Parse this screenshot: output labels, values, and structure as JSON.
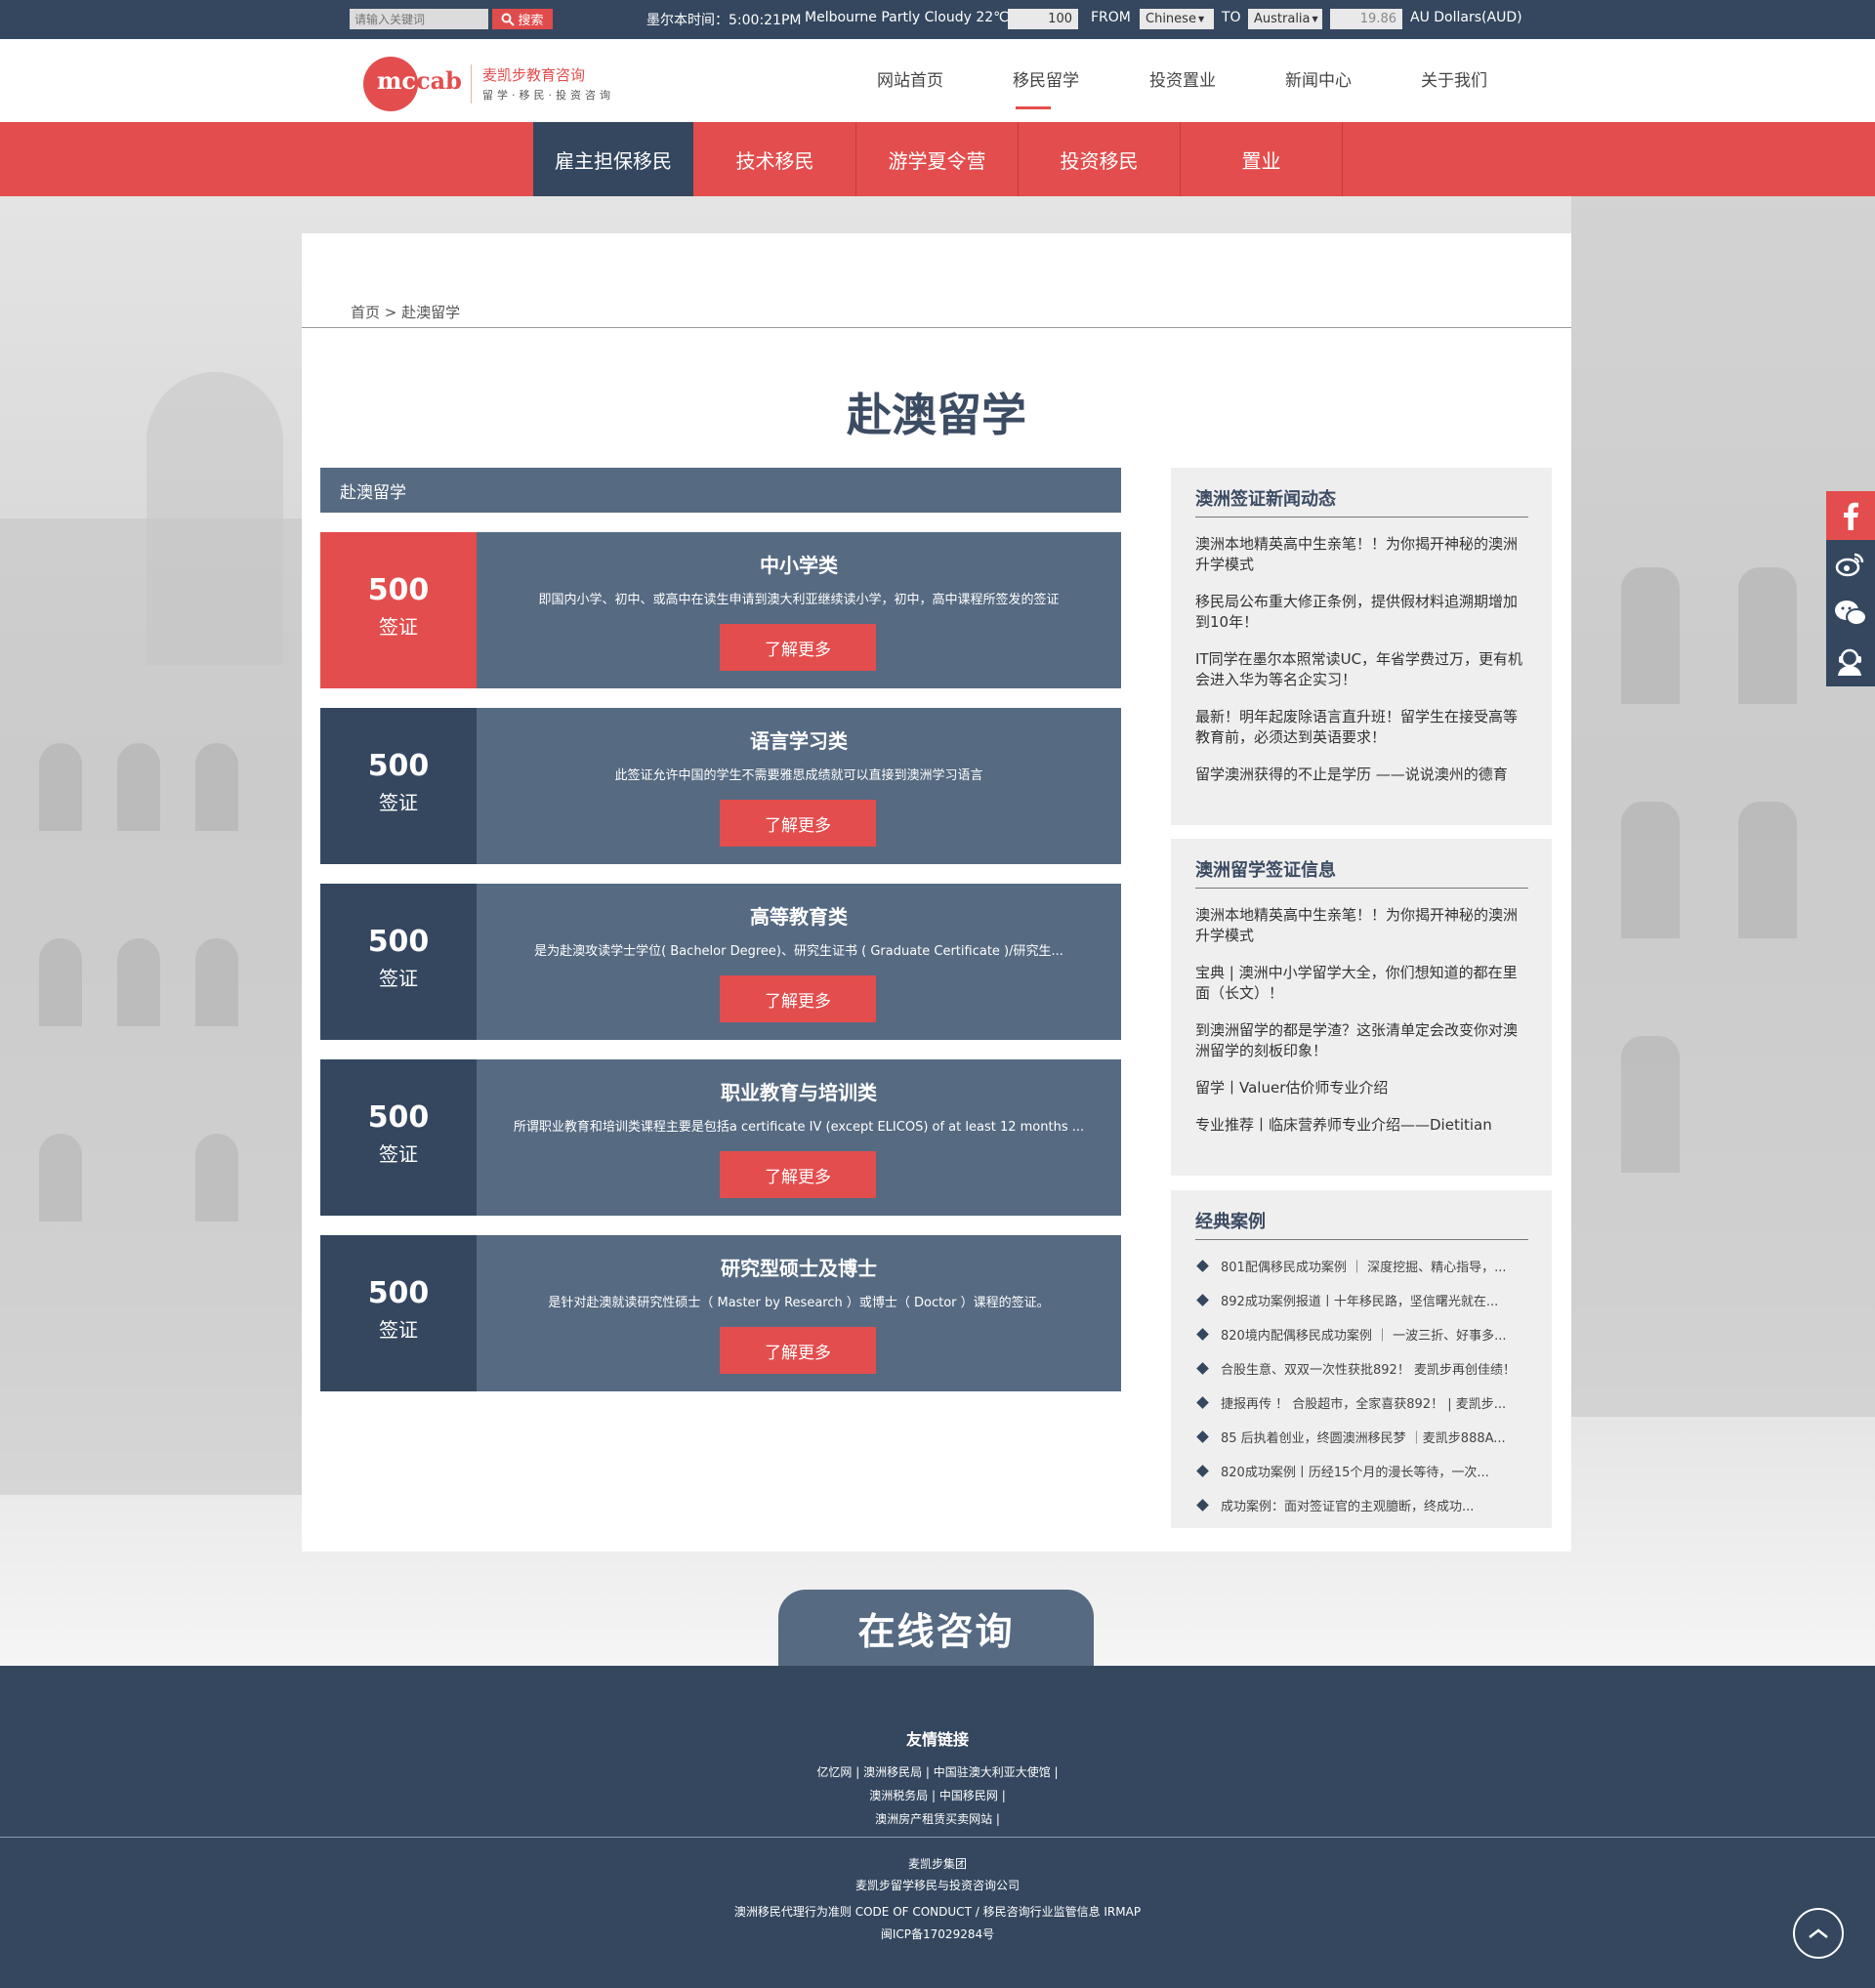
{
  "topbar": {
    "search_placeholder": "请输入关键词",
    "search_button": "搜索",
    "time_label": "墨尔本时间：5:00:21PM",
    "weather": "Melbourne Partly Cloudy 22℃",
    "amount": "100",
    "from_label": "FROM",
    "from_currency": "Chinese",
    "to_label": "TO",
    "to_currency": "Australia",
    "result": "19.86",
    "result_unit": "AU Dollars(AUD)"
  },
  "header": {
    "logo_mc": "mc",
    "logo_cab": "cab",
    "brand_cn": "麦凯步教育咨询",
    "brand_sub": "留学·移民·投资咨询",
    "nav": [
      "网站首页",
      "移民留学",
      "投资置业",
      "新闻中心",
      "关于我们"
    ]
  },
  "subnav": [
    "雇主担保移民",
    "技术移民",
    "游学夏令营",
    "投资移民",
    "置业"
  ],
  "breadcrumb": {
    "home": "首页",
    "separator": ">",
    "current": "赴澳留学"
  },
  "page_title": "赴澳留学",
  "category_header": "赴澳留学",
  "cards": [
    {
      "num": "500",
      "visa": "签证",
      "title": "中小学类",
      "desc": "即国内小学、初中、或高中在读生申请到澳大利亚继续读小学，初中，高中课程所签发的签证",
      "button": "了解更多"
    },
    {
      "num": "500",
      "visa": "签证",
      "title": "语言学习类",
      "desc": "此签证允许中国的学生不需要雅思成绩就可以直接到澳洲学习语言",
      "button": "了解更多"
    },
    {
      "num": "500",
      "visa": "签证",
      "title": "高等教育类",
      "desc": "是为赴澳攻读学士学位( Bachelor Degree)、研究生证书 ( Graduate Certificate )/研究生...",
      "button": "了解更多"
    },
    {
      "num": "500",
      "visa": "签证",
      "title": "职业教育与培训类",
      "desc": "所谓职业教育和培训类课程主要是包括a certificate IV (except ELICOS) of at least 12 months ...",
      "button": "了解更多"
    },
    {
      "num": "500",
      "visa": "签证",
      "title": "研究型硕士及博士",
      "desc": "是针对赴澳就读研究性硕士（ Master by Research ）或博士（ Doctor ）课程的签证。",
      "button": "了解更多"
    }
  ],
  "sidebar": {
    "news": {
      "title": "澳洲签证新闻动态",
      "items": [
        "澳洲本地精英高中生亲笔！！为你揭开神秘的澳洲升学模式",
        "移民局公布重大修正条例，提供假材料追溯期增加到10年！",
        "IT同学在墨尔本照常读UC，年省学费过万，更有机会进入华为等名企实习！",
        "最新！明年起废除语言直升班！留学生在接受高等教育前，必须达到英语要求！",
        "留学澳洲获得的不止是学历 ——说说澳州的德育"
      ]
    },
    "visa": {
      "title": "澳洲留学签证信息",
      "items": [
        "澳洲本地精英高中生亲笔！！为你揭开神秘的澳洲升学模式",
        "宝典 | 澳洲中小学留学大全，你们想知道的都在里面（长文）！",
        "到澳洲留学的都是学渣？这张清单定会改变你对澳洲留学的刻板印象！",
        "留学丨Valuer估价师专业介绍",
        "专业推荐丨临床营养师专业介绍——Dietitian"
      ]
    },
    "cases": {
      "title": "经典案例",
      "items": [
        "801配偶移民成功案例 ｜ 深度挖掘、精心指导，...",
        "892成功案例报道丨十年移民路，坚信曙光就在...",
        "820境内配偶移民成功案例 ｜ 一波三折、好事多...",
        "合股生意、双双一次性获批892！ 麦凯步再创佳绩！",
        "捷报再传 ！ 合股超市，全家喜获892！ | 麦凯步...",
        "85 后执着创业，终圆澳洲移民梦 ｜麦凯步888A...",
        "820成功案例丨历经15个月的漫长等待，一次...",
        "成功案例：面对签证官的主观臆断，终成功..."
      ]
    }
  },
  "consult_label": "在线咨询",
  "footer": {
    "links_title": "友情链接",
    "links_line1": "亿忆网 | 澳洲移民局 | 中国驻澳大利亚大使馆 |",
    "links_line2": "澳洲税务局 | 中国移民网 |",
    "links_line3": "澳洲房产租赁买卖网站 |",
    "company1": "麦凯步集团",
    "company2": "麦凯步留学移民与投资咨询公司",
    "conduct": "澳洲移民代理行为准则 CODE OF CONDUCT / 移民咨询行业监管信息 IRMAP",
    "icp": "闽ICP备17029284号"
  },
  "colors": {
    "navy": "#34475f",
    "slate": "#566a82",
    "red": "#e44d4d"
  },
  "icons": [
    "search-icon",
    "dropdown-arrow-icon",
    "facebook-icon",
    "weibo-icon",
    "wechat-icon",
    "customer-service-icon",
    "back-to-top-icon"
  ]
}
